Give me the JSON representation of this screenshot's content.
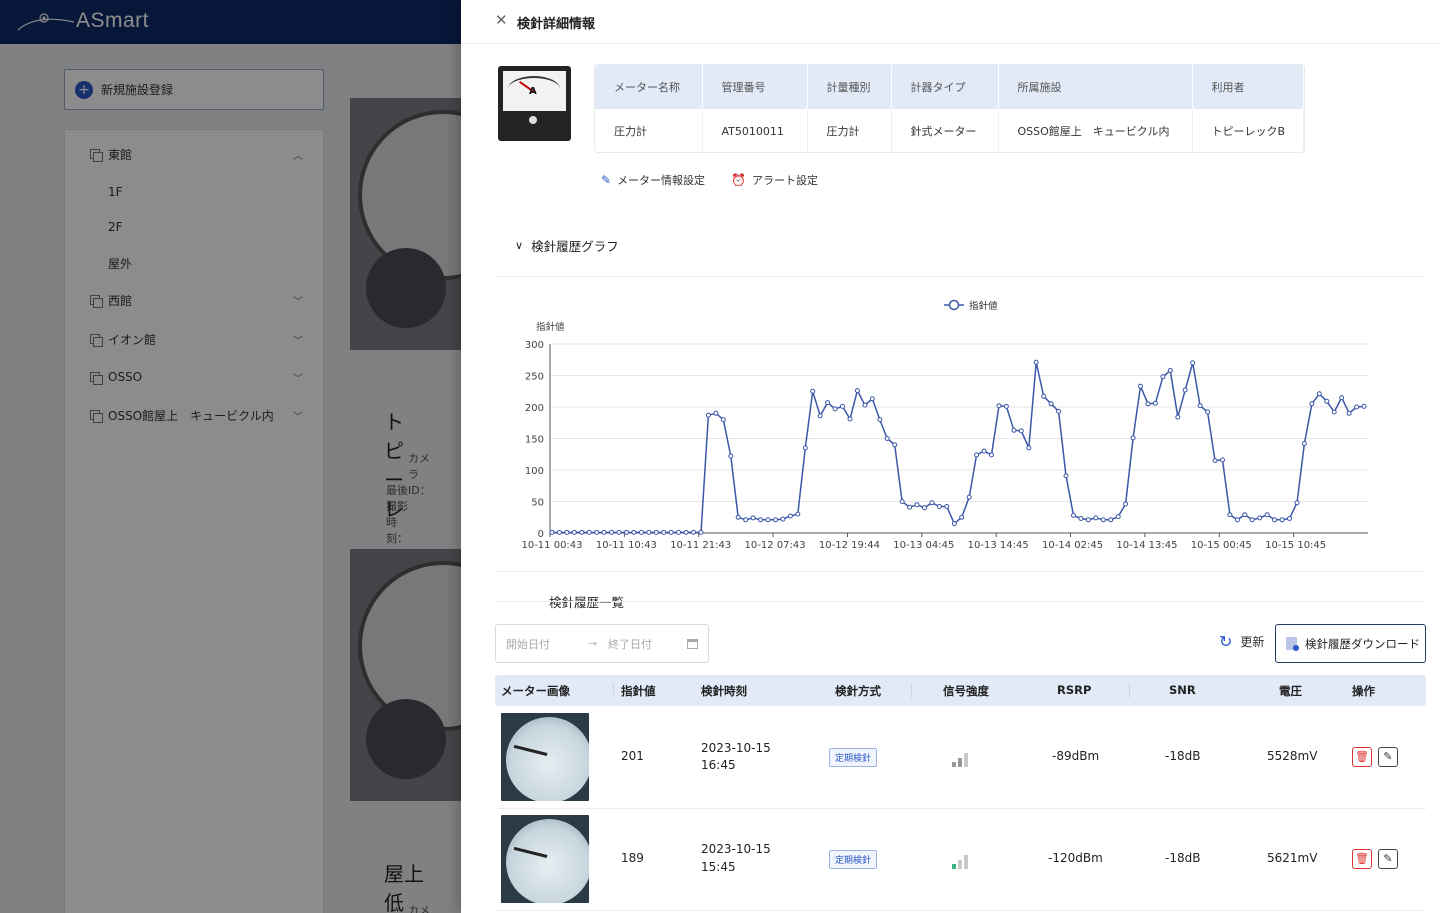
{
  "app": {
    "brand": "ASmart"
  },
  "sidebar": {
    "new_facility_label": "新規施設登録",
    "items": [
      {
        "label": "東館",
        "expanded": true,
        "children": [
          "1F",
          "2F",
          "屋外"
        ]
      },
      {
        "label": "西館"
      },
      {
        "label": "イオン館"
      },
      {
        "label": "OSSO"
      },
      {
        "label": "OSSO館屋上　キュービクル内"
      }
    ]
  },
  "cards": [
    {
      "title": "トピーレ",
      "meta1": "カメラID：",
      "meta2": "最後撮影時刻："
    },
    {
      "title": "屋上　低",
      "meta1": "カメラID："
    }
  ],
  "drawer": {
    "title": "検針詳細情報",
    "meter_info": {
      "headers": [
        "メーター名称",
        "管理番号",
        "計量種別",
        "計器タイプ",
        "所属施設",
        "利用者"
      ],
      "values": [
        "圧力計",
        "AT5010011",
        "圧力計",
        "針式メーター",
        "OSSO館屋上　キュービクル内",
        "トピーレックB"
      ]
    },
    "links": {
      "meter_settings": "メーター情報設定",
      "alert_settings": "アラート設定"
    },
    "graph_section_title": "検針履歴グラフ",
    "list_section_title": "検針履歴一覧",
    "date_range": {
      "start_placeholder": "開始日付",
      "end_placeholder": "終了日付",
      "arrow": "→"
    },
    "refresh_label": "更新",
    "download_label": "検針履歴ダウンロード",
    "table": {
      "headers": [
        "メーター画像",
        "指針値",
        "検針時刻",
        "検針方式",
        "信号強度",
        "RSRP",
        "SNR",
        "電圧",
        "操作"
      ],
      "rows": [
        {
          "value": "201",
          "date": "2023-10-15",
          "time": "16:45",
          "method": "定期検針",
          "signal_level": 2,
          "rsrp": "-89dBm",
          "snr": "-18dB",
          "voltage": "5528mV"
        },
        {
          "value": "189",
          "date": "2023-10-15",
          "time": "15:45",
          "method": "定期検針",
          "signal_level": 1,
          "rsrp": "-120dBm",
          "snr": "-18dB",
          "voltage": "5621mV"
        }
      ]
    }
  },
  "colors": {
    "brand_navy": "#0d2b6b",
    "accent_blue": "#2a59c8",
    "line_series": "#3b57a8",
    "delete_red": "#d33333",
    "signal_green": "#36b37e"
  },
  "chart_data": {
    "type": "line",
    "legend": [
      "指針値"
    ],
    "legend_position": "top-center",
    "ylabel": "指針値",
    "ylim": [
      0,
      300
    ],
    "yticks": [
      0,
      50,
      100,
      150,
      200,
      250,
      300
    ],
    "xtick_labels": [
      "10-11 00:43",
      "10-11 10:43",
      "10-11 21:43",
      "10-12 07:43",
      "10-12 19:44",
      "10-13 04:45",
      "10-13 14:45",
      "10-14 02:45",
      "10-14 13:45",
      "10-15 00:45",
      "10-15 10:45"
    ],
    "grid": true,
    "series": [
      {
        "name": "指針値",
        "values": [
          1,
          1,
          1,
          1,
          1,
          1,
          1,
          1,
          1,
          1,
          1,
          1,
          1,
          1,
          1,
          1,
          1,
          1,
          1,
          1,
          1,
          187,
          190,
          180,
          122,
          25,
          21,
          24,
          21,
          21,
          21,
          22,
          27,
          30,
          135,
          225,
          186,
          207,
          197,
          201,
          181,
          226,
          203,
          213,
          180,
          150,
          140,
          50,
          41,
          45,
          40,
          48,
          42,
          42,
          15,
          25,
          57,
          124,
          130,
          124,
          202,
          201,
          163,
          162,
          135,
          271,
          217,
          205,
          193,
          91,
          28,
          23,
          21,
          24,
          21,
          21,
          26,
          46,
          151,
          233,
          205,
          206,
          248,
          258,
          184,
          227,
          270,
          202,
          192,
          115,
          116,
          29,
          21,
          29,
          21,
          24,
          29,
          21,
          21,
          23,
          48,
          142,
          205,
          221,
          209,
          192,
          215,
          190,
          200,
          201
        ]
      }
    ]
  }
}
